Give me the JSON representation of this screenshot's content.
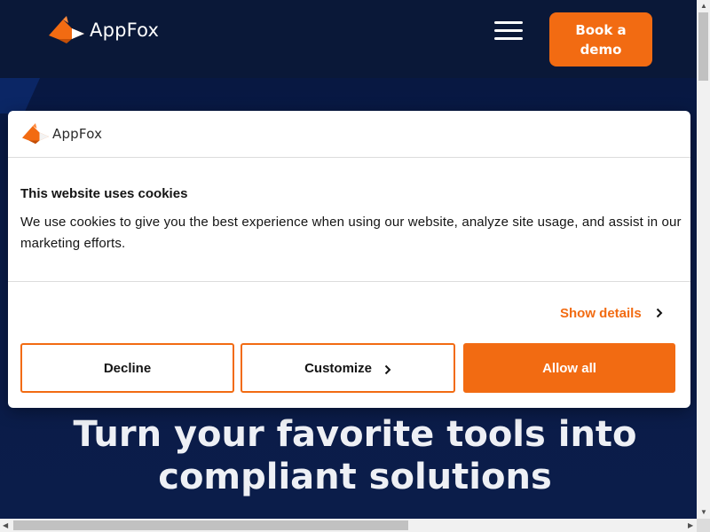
{
  "header": {
    "logo_text": "AppFox",
    "book_demo_label": "Book a demo"
  },
  "hero": {
    "title": "Turn your favorite tools into compliant solutions"
  },
  "cookie_dialog": {
    "logo_text": "AppFox",
    "title": "This website uses cookies",
    "body": "We use cookies to give you the best experience when using our website, analyze site usage, and assist in our marketing efforts.",
    "show_details_label": "Show details",
    "decline_label": "Decline",
    "customize_label": "Customize",
    "allow_all_label": "Allow all"
  },
  "colors": {
    "accent": "#f26b12",
    "header_bg": "#0a1838",
    "hero_bg": "#0b1d4a"
  },
  "icons": [
    "fox-logo-icon",
    "hamburger-menu-icon",
    "chevron-right-icon"
  ]
}
